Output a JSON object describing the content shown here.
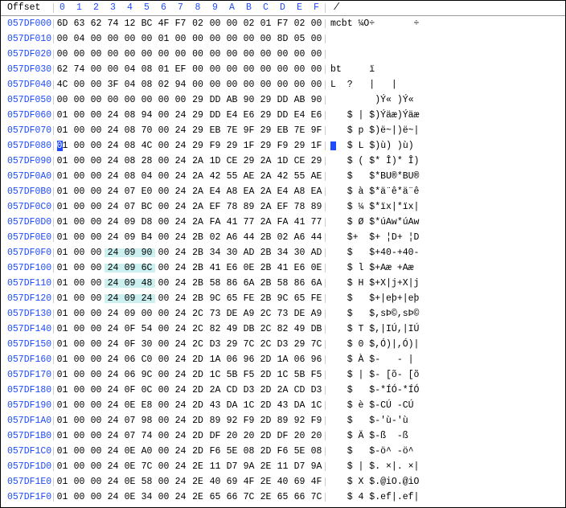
{
  "header": {
    "offset_label": "Offset",
    "col_labels": [
      "0",
      "1",
      "2",
      "3",
      "4",
      "5",
      "6",
      "7",
      "8",
      "9",
      "A",
      "B",
      "C",
      "D",
      "E",
      "F"
    ],
    "slash": "/"
  },
  "rows": [
    {
      "offset": "057DF000",
      "hex": [
        "6D",
        "63",
        "62",
        "74",
        "12",
        "BC",
        "4F",
        "F7",
        "02",
        "00",
        "00",
        "02",
        "01",
        "F7",
        "02",
        "00"
      ],
      "ascii": "mcbt ¼O÷       ÷"
    },
    {
      "offset": "057DF010",
      "hex": [
        "00",
        "04",
        "00",
        "00",
        "00",
        "00",
        "01",
        "00",
        "00",
        "00",
        "00",
        "00",
        "00",
        "8D",
        "05",
        "00"
      ],
      "ascii": ""
    },
    {
      "offset": "057DF020",
      "hex": [
        "00",
        "00",
        "00",
        "00",
        "00",
        "00",
        "00",
        "00",
        "00",
        "00",
        "00",
        "00",
        "00",
        "00",
        "00",
        "00"
      ],
      "ascii": ""
    },
    {
      "offset": "057DF030",
      "hex": [
        "62",
        "74",
        "00",
        "00",
        "04",
        "08",
        "01",
        "EF",
        "00",
        "00",
        "00",
        "00",
        "00",
        "00",
        "00",
        "00"
      ],
      "ascii": "bt     ï"
    },
    {
      "offset": "057DF040",
      "hex": [
        "4C",
        "00",
        "00",
        "3F",
        "04",
        "08",
        "02",
        "94",
        "00",
        "00",
        "00",
        "00",
        "00",
        "00",
        "00",
        "00"
      ],
      "ascii": "L  ?   |   |"
    },
    {
      "offset": "057DF050",
      "hex": [
        "00",
        "00",
        "00",
        "00",
        "00",
        "00",
        "00",
        "00",
        "29",
        "DD",
        "AB",
        "90",
        "29",
        "DD",
        "AB",
        "90"
      ],
      "ascii": "        )Ý« )Ý«"
    },
    {
      "offset": "057DF060",
      "hex": [
        "01",
        "00",
        "00",
        "24",
        "08",
        "94",
        "00",
        "24",
        "29",
        "DD",
        "E4",
        "E6",
        "29",
        "DD",
        "E4",
        "E6"
      ],
      "ascii": "   $ | $)Ýäæ)Ýäæ"
    },
    {
      "offset": "057DF070",
      "hex": [
        "01",
        "00",
        "00",
        "24",
        "08",
        "70",
        "00",
        "24",
        "29",
        "EB",
        "7E",
        "9F",
        "29",
        "EB",
        "7E",
        "9F"
      ],
      "ascii": "   $ p $)ë~|)ë~|"
    },
    {
      "offset": "057DF080",
      "cursor": 0,
      "hex": [
        "01",
        "00",
        "00",
        "24",
        "08",
        "4C",
        "00",
        "24",
        "29",
        "F9",
        "29",
        "1F",
        "29",
        "F9",
        "29",
        "1F"
      ],
      "ascii": "   $ L $)ù) )ù)",
      "ascii_cursor": 0
    },
    {
      "offset": "057DF090",
      "hex": [
        "01",
        "00",
        "00",
        "24",
        "08",
        "28",
        "00",
        "24",
        "2A",
        "1D",
        "CE",
        "29",
        "2A",
        "1D",
        "CE",
        "29"
      ],
      "ascii": "   $ ( $* Î)* Î)"
    },
    {
      "offset": "057DF0A0",
      "hex": [
        "01",
        "00",
        "00",
        "24",
        "08",
        "04",
        "00",
        "24",
        "2A",
        "42",
        "55",
        "AE",
        "2A",
        "42",
        "55",
        "AE"
      ],
      "ascii": "   $   $*BU®*BU®"
    },
    {
      "offset": "057DF0B0",
      "hex": [
        "01",
        "00",
        "00",
        "24",
        "07",
        "E0",
        "00",
        "24",
        "2A",
        "E4",
        "A8",
        "EA",
        "2A",
        "E4",
        "A8",
        "EA"
      ],
      "ascii": "   $ à $*ä¨ê*ä¨ê"
    },
    {
      "offset": "057DF0C0",
      "hex": [
        "01",
        "00",
        "00",
        "24",
        "07",
        "BC",
        "00",
        "24",
        "2A",
        "EF",
        "78",
        "89",
        "2A",
        "EF",
        "78",
        "89"
      ],
      "ascii": "   $ ¼ $*ïx|*ïx|"
    },
    {
      "offset": "057DF0D0",
      "hex": [
        "01",
        "00",
        "00",
        "24",
        "09",
        "D8",
        "00",
        "24",
        "2A",
        "FA",
        "41",
        "77",
        "2A",
        "FA",
        "41",
        "77"
      ],
      "ascii": "   $ Ø $*úAw*úAw"
    },
    {
      "offset": "057DF0E0",
      "hex": [
        "01",
        "00",
        "00",
        "24",
        "09",
        "B4",
        "00",
        "24",
        "2B",
        "02",
        "A6",
        "44",
        "2B",
        "02",
        "A6",
        "44"
      ],
      "ascii": "   $+  $+ ¦D+ ¦D"
    },
    {
      "offset": "057DF0F0",
      "hl": "cyan",
      "hex": [
        "01",
        "00",
        "00",
        "24",
        "09",
        "90",
        "00",
        "24",
        "2B",
        "34",
        "30",
        "AD",
        "2B",
        "34",
        "30",
        "AD"
      ],
      "ascii": "   $   $+40-+40-"
    },
    {
      "offset": "057DF100",
      "hl": "cyan",
      "hex": [
        "01",
        "00",
        "00",
        "24",
        "09",
        "6C",
        "00",
        "24",
        "2B",
        "41",
        "E6",
        "0E",
        "2B",
        "41",
        "E6",
        "0E"
      ],
      "ascii": "   $ l $+Aæ +Aæ"
    },
    {
      "offset": "057DF110",
      "hl": "cyan",
      "hex": [
        "01",
        "00",
        "00",
        "24",
        "09",
        "48",
        "00",
        "24",
        "2B",
        "58",
        "86",
        "6A",
        "2B",
        "58",
        "86",
        "6A"
      ],
      "ascii": "   $ H $+X|j+X|j"
    },
    {
      "offset": "057DF120",
      "hl": "cyan",
      "hex": [
        "01",
        "00",
        "00",
        "24",
        "09",
        "24",
        "00",
        "24",
        "2B",
        "9C",
        "65",
        "FE",
        "2B",
        "9C",
        "65",
        "FE"
      ],
      "ascii": "   $   $+|eþ+|eþ"
    },
    {
      "offset": "057DF130",
      "hex": [
        "01",
        "00",
        "00",
        "24",
        "09",
        "00",
        "00",
        "24",
        "2C",
        "73",
        "DE",
        "A9",
        "2C",
        "73",
        "DE",
        "A9"
      ],
      "ascii": "   $   $,sÞ©,sÞ©"
    },
    {
      "offset": "057DF140",
      "hex": [
        "01",
        "00",
        "00",
        "24",
        "0F",
        "54",
        "00",
        "24",
        "2C",
        "82",
        "49",
        "DB",
        "2C",
        "82",
        "49",
        "DB"
      ],
      "ascii": "   $ T $,|IÚ,|IÚ"
    },
    {
      "offset": "057DF150",
      "hex": [
        "01",
        "00",
        "00",
        "24",
        "0F",
        "30",
        "00",
        "24",
        "2C",
        "D3",
        "29",
        "7C",
        "2C",
        "D3",
        "29",
        "7C"
      ],
      "ascii": "   $ 0 $,Ó)|,Ó)|"
    },
    {
      "offset": "057DF160",
      "hex": [
        "01",
        "00",
        "00",
        "24",
        "06",
        "C0",
        "00",
        "24",
        "2D",
        "1A",
        "06",
        "96",
        "2D",
        "1A",
        "06",
        "96"
      ],
      "ascii": "   $ À $-   - |"
    },
    {
      "offset": "057DF170",
      "hex": [
        "01",
        "00",
        "00",
        "24",
        "06",
        "9C",
        "00",
        "24",
        "2D",
        "1C",
        "5B",
        "F5",
        "2D",
        "1C",
        "5B",
        "F5"
      ],
      "ascii": "   $ | $- [õ- [õ"
    },
    {
      "offset": "057DF180",
      "hex": [
        "01",
        "00",
        "00",
        "24",
        "0F",
        "0C",
        "00",
        "24",
        "2D",
        "2A",
        "CD",
        "D3",
        "2D",
        "2A",
        "CD",
        "D3"
      ],
      "ascii": "   $   $-*ÍÓ-*ÍÓ"
    },
    {
      "offset": "057DF190",
      "hex": [
        "01",
        "00",
        "00",
        "24",
        "0E",
        "E8",
        "00",
        "24",
        "2D",
        "43",
        "DA",
        "1C",
        "2D",
        "43",
        "DA",
        "1C"
      ],
      "ascii": "   $ è $-CÚ -CÚ"
    },
    {
      "offset": "057DF1A0",
      "hex": [
        "01",
        "00",
        "00",
        "24",
        "07",
        "98",
        "00",
        "24",
        "2D",
        "89",
        "92",
        "F9",
        "2D",
        "89",
        "92",
        "F9"
      ],
      "ascii": "   $   $-'ù-'ù"
    },
    {
      "offset": "057DF1B0",
      "hex": [
        "01",
        "00",
        "00",
        "24",
        "07",
        "74",
        "00",
        "24",
        "2D",
        "DF",
        "20",
        "20",
        "2D",
        "DF",
        "20",
        "20"
      ],
      "ascii": "   $ Ä $-ß  -ß"
    },
    {
      "offset": "057DF1C0",
      "hex": [
        "01",
        "00",
        "00",
        "24",
        "0E",
        "A0",
        "00",
        "24",
        "2D",
        "F6",
        "5E",
        "08",
        "2D",
        "F6",
        "5E",
        "08"
      ],
      "ascii": "   $   $-ö^ -ö^"
    },
    {
      "offset": "057DF1D0",
      "hex": [
        "01",
        "00",
        "00",
        "24",
        "0E",
        "7C",
        "00",
        "24",
        "2E",
        "11",
        "D7",
        "9A",
        "2E",
        "11",
        "D7",
        "9A"
      ],
      "ascii": "   $ | $. ×|. ×|"
    },
    {
      "offset": "057DF1E0",
      "hex": [
        "01",
        "00",
        "00",
        "24",
        "0E",
        "58",
        "00",
        "24",
        "2E",
        "40",
        "69",
        "4F",
        "2E",
        "40",
        "69",
        "4F"
      ],
      "ascii": "   $ X $.@iO.@iO"
    },
    {
      "offset": "057DF1F0",
      "hex": [
        "01",
        "00",
        "00",
        "24",
        "0E",
        "34",
        "00",
        "24",
        "2E",
        "65",
        "66",
        "7C",
        "2E",
        "65",
        "66",
        "7C"
      ],
      "ascii": "   $ 4 $.ef|.ef|"
    }
  ]
}
